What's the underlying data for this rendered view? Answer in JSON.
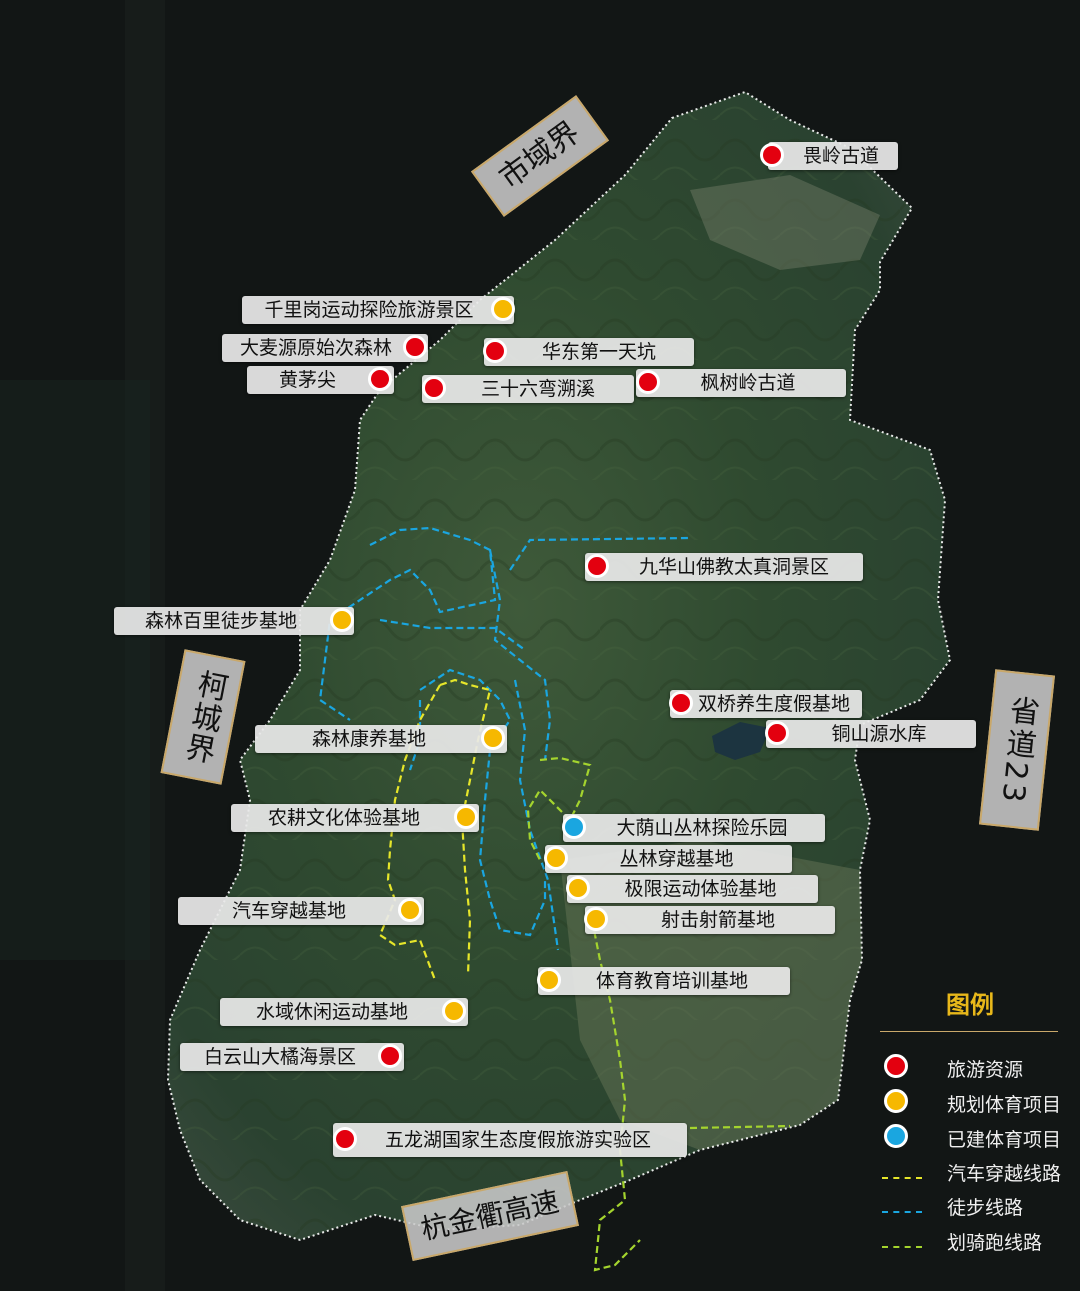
{
  "boundaries": {
    "city": "市域界",
    "county": "柯城界",
    "highway": "杭金衢高速",
    "provincial_road": "省道23"
  },
  "places": {
    "weiling": "畏岭古道",
    "qianligang": "千里岗运动探险旅游景区",
    "damaiyuan": "大麦源原始次森林",
    "huadong": "华东第一天坑",
    "huangmaojian": "黄茅尖",
    "sanshiliu": "三十六弯溯溪",
    "fengshuling": "枫树岭古道",
    "jiuhuashan": "九华山佛教太真洞景区",
    "senlin_baili": "森林百里徒步基地",
    "shuangqiao": "双桥养生度假基地",
    "tongshanyuan": "铜山源水库",
    "senlin_kangyang": "森林康养基地",
    "nonggeng": "农耕文化体验基地",
    "dayinshan": "大荫山丛林探险乐园",
    "conglin": "丛林穿越基地",
    "jixian": "极限运动体验基地",
    "qiche": "汽车穿越基地",
    "sheji": "射击射箭基地",
    "tiyu": "体育教育培训基地",
    "shuiyu": "水域休闲运动基地",
    "baiyunshan": "白云山大橘海景区",
    "wulonghu": "五龙湖国家生态度假旅游实验区"
  },
  "legend": {
    "title": "图例",
    "tourism": "旅游资源",
    "planned": "规划体育项目",
    "built": "已建体育项目",
    "car_route": "汽车穿越线路",
    "hiking_route": "徒步线路",
    "paddle_run_route": "划骑跑线路"
  },
  "colors": {
    "tourism_resource": "#e3000f",
    "planned_sports": "#f6b800",
    "built_sports": "#1aa6e0",
    "car_route": "#e6e62a",
    "hiking_route": "#1aa6e0",
    "paddle_run_route": "#a4d42e",
    "sign_border": "#c9a86a",
    "legend_title": "#e8b81a"
  }
}
